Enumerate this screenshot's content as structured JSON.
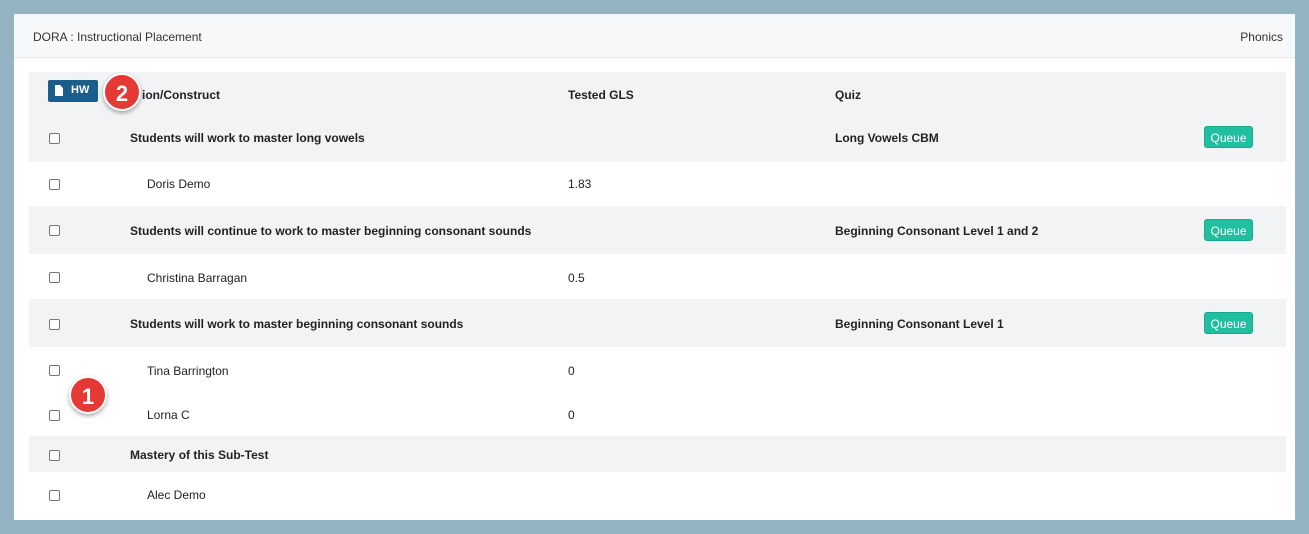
{
  "header": {
    "title": "DORA : Instructional Placement",
    "subtest": "Phonics"
  },
  "toolbar": {
    "hw_label": "HW"
  },
  "columns": {
    "construct": "Instruction/Construct",
    "construct_visible": "ion/Construct",
    "gls": "Tested GLS",
    "quiz": "Quiz"
  },
  "groups": [
    {
      "name": "Students will work to master long vowels",
      "quiz": "Long Vowels CBM",
      "action": "Queue",
      "students": [
        {
          "name": "Doris Demo",
          "gls": "1.83"
        }
      ]
    },
    {
      "name": "Students will continue to work to master beginning consonant sounds",
      "quiz": "Beginning Consonant Level 1 and 2",
      "action": "Queue",
      "students": [
        {
          "name": "Christina Barragan",
          "gls": "0.5"
        }
      ]
    },
    {
      "name": "Students will work to master beginning consonant sounds",
      "quiz": "Beginning Consonant Level 1",
      "action": "Queue",
      "students": [
        {
          "name": "Tina Barrington",
          "gls": "0"
        },
        {
          "name": "Lorna C",
          "gls": "0"
        }
      ]
    },
    {
      "name": "Mastery of this Sub-Test",
      "quiz": "",
      "action": "",
      "students": [
        {
          "name": "Alec Demo",
          "gls": ""
        }
      ]
    }
  ],
  "annotations": {
    "badge_1": "1",
    "badge_2": "2"
  },
  "colors": {
    "background": "#94b3c3",
    "queue_button": "#1fbfa0",
    "hw_button": "#1b5e8c",
    "badge": "#e53935"
  }
}
